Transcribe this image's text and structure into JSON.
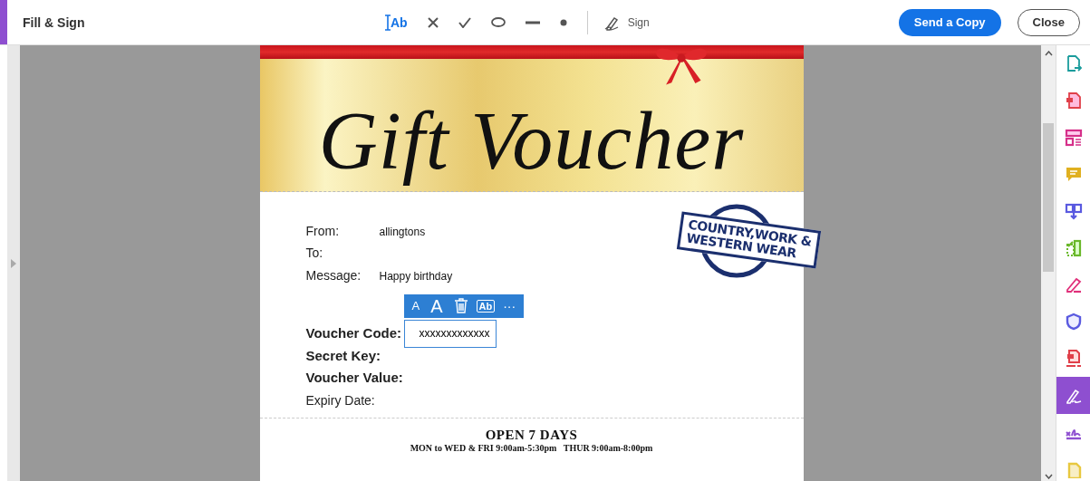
{
  "toolbar": {
    "title": "Fill & Sign",
    "tools": [
      {
        "kind": "text",
        "label": "Ab",
        "selected": true
      },
      {
        "kind": "cross",
        "selected": false
      },
      {
        "kind": "check",
        "selected": false
      },
      {
        "kind": "ellipse",
        "selected": false
      },
      {
        "kind": "line",
        "selected": false
      },
      {
        "kind": "dot",
        "selected": false
      }
    ],
    "sign_label": "Sign",
    "send_button": "Send a Copy",
    "close_button": "Close"
  },
  "voucher": {
    "title": "Gift Voucher",
    "stamp_lines": [
      "COUNTRY,WORK &",
      "WESTERN WEAR"
    ],
    "fields": [
      {
        "label": "From:",
        "value": "allingtons",
        "bold": false
      },
      {
        "label": "To:",
        "bold": false
      },
      {
        "label": "Message:",
        "value": "Happy birthday",
        "bold": false
      },
      {
        "label": "Voucher Code:",
        "value": "xxxxxxxxxxxxx",
        "bold": true,
        "editing": true
      },
      {
        "label": "Secret Key:",
        "bold": true
      },
      {
        "label": "Voucher Value:",
        "bold": true
      },
      {
        "label": "Expiry Date:",
        "bold": false
      }
    ],
    "field_toolbar": [
      {
        "kind": "smaller",
        "label": "A"
      },
      {
        "kind": "larger",
        "label": "A"
      },
      {
        "kind": "delete"
      },
      {
        "kind": "field",
        "label": "Ab"
      },
      {
        "kind": "more",
        "label": "···"
      }
    ],
    "footer_title": "OPEN 7 DAYS",
    "footer_hours": "MON to WED & FRI 9:00am-5:30pm   THUR 9:00am-8:00pm"
  },
  "right_rail": [
    {
      "kind": "export",
      "color": "#1a9c9c",
      "selected": false
    },
    {
      "kind": "create",
      "color": "#e0404a",
      "selected": false
    },
    {
      "kind": "organize",
      "color": "#d6308a",
      "selected": false
    },
    {
      "kind": "comment",
      "color": "#e0b020",
      "selected": false
    },
    {
      "kind": "combine",
      "color": "#5a5ae0",
      "selected": false
    },
    {
      "kind": "compress",
      "color": "#6ab82a",
      "selected": false
    },
    {
      "kind": "edit",
      "color": "#e0307a",
      "selected": false
    },
    {
      "kind": "protect",
      "color": "#5a5ae0",
      "selected": false
    },
    {
      "kind": "redact",
      "color": "#e0404a",
      "selected": false
    },
    {
      "kind": "sign",
      "color": "#8e4fd0",
      "selected": true
    },
    {
      "kind": "request",
      "color": "#8e4fd0",
      "selected": false
    },
    {
      "kind": "more",
      "color": "#e8c840",
      "selected": false
    }
  ]
}
